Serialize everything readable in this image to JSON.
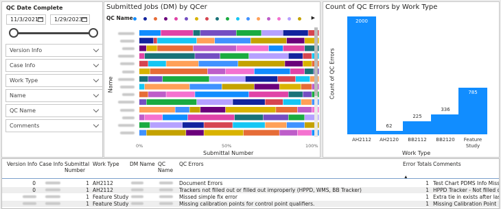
{
  "slicer": {
    "title": "QC Date Complete",
    "start_date": "11/3/2021",
    "end_date": "1/29/2023",
    "dropdowns": [
      "Version Info",
      "Case Info",
      "Work Type",
      "Name",
      "QC Name",
      "Comments"
    ]
  },
  "jobs_chart": {
    "title": "Submitted Jobs (DM) by QCer",
    "legend_title": "QC Name",
    "legend_colors": [
      "#118DFF",
      "#12239E",
      "#E66C37",
      "#6B007B",
      "#E044A7",
      "#744EC2",
      "#D9B300",
      "#D64550",
      "#197278",
      "#1AAB40",
      "#15C6F4",
      "#4092FF",
      "#FFA058",
      "#BE5DC9",
      "#F472D0",
      "#B5A1FF",
      "#C4A200"
    ],
    "y_axis_title": "Name",
    "x_axis_title": "Submittal Number",
    "x_ticks": [
      "0%",
      "50%",
      "100%"
    ]
  },
  "chart_data": {
    "type": "bar",
    "title": "Count of QC Errors by Work Type",
    "categories": [
      "AH2112",
      "AH2120",
      "BB2112",
      "BB2120",
      "Feature Study"
    ],
    "values": [
      2000,
      62,
      225,
      336,
      785
    ],
    "xlabel": "Work Type",
    "ylabel": "Count of QC Errors",
    "color": "#118DFF"
  },
  "table": {
    "headers": {
      "version": "Version Info",
      "case": "Case Info",
      "submittal": "Submittal Number",
      "worktype": "Work Type",
      "dm": "DM Name",
      "qc": "QC Name",
      "errors": "QC Errors",
      "totals": "Error Totals",
      "comments": "Comments"
    },
    "sort_arrow": "▲",
    "rows": [
      {
        "version": "0",
        "submittal": "1",
        "worktype": "AH2112",
        "errors": "Document Errors",
        "totals": "1",
        "comments": "Test Chart PDMS Info Missi"
      },
      {
        "version": "0",
        "submittal": "1",
        "worktype": "AH2112",
        "errors": "Trackers not filled out or filled out improperly (HPPD, WMS, BB Tracker)",
        "totals": "1",
        "comments": "HPPD Tracker - Not filled o"
      },
      {
        "version": "",
        "submittal": "1",
        "worktype": "Feature Study",
        "errors": "Missed simple fix error",
        "totals": "1",
        "comments": "Extra tie in exists after last"
      },
      {
        "version": "",
        "submittal": "1",
        "worktype": "Feature Study",
        "errors": "Missing calibration points for control point qualifiers.",
        "totals": "1",
        "comments": "Missing Calibration Point"
      }
    ]
  }
}
